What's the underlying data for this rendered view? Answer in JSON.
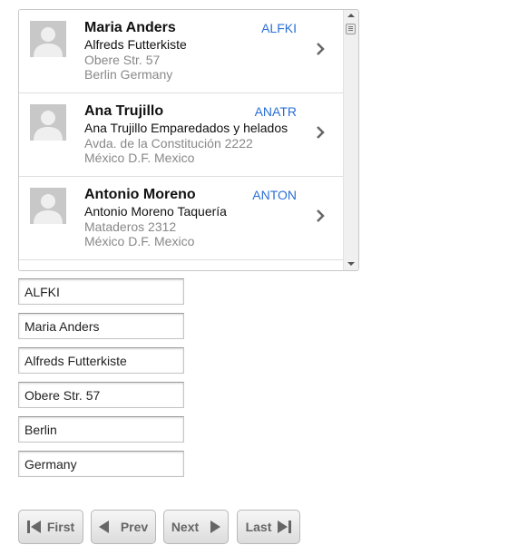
{
  "customers": [
    {
      "name": "Maria Anders",
      "company": "Alfreds Futterkiste",
      "address": "Obere Str. 57",
      "city_country": "Berlin Germany",
      "id": "ALFKI"
    },
    {
      "name": "Ana Trujillo",
      "company": "Ana Trujillo Emparedados y helados",
      "address": "Avda. de la Constitución 2222",
      "city_country": "México D.F. Mexico",
      "id": "ANATR"
    },
    {
      "name": "Antonio Moreno",
      "company": "Antonio Moreno Taquería",
      "address": "Mataderos 2312",
      "city_country": "México D.F. Mexico",
      "id": "ANTON"
    }
  ],
  "icons": {
    "avatar": "person-silhouette-icon",
    "row_action": "chevron-right-icon",
    "first": "skip-first-icon",
    "prev": "triangle-left-icon",
    "next": "triangle-right-icon",
    "last": "skip-last-icon"
  },
  "detail_form": {
    "customer_id": "ALFKI",
    "contact_name": "Maria Anders",
    "company_name": "Alfreds Futterkiste",
    "address": "Obere Str. 57",
    "city": "Berlin",
    "country": "Germany"
  },
  "pager": {
    "first_label": "First",
    "prev_label": "Prev",
    "next_label": "Next",
    "last_label": "Last"
  },
  "colors": {
    "id_link": "#2a6fd6",
    "secondary_text": "#888888"
  }
}
